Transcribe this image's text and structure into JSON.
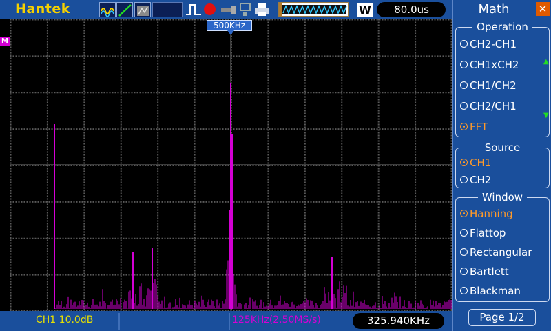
{
  "header": {
    "brand": "Hantek",
    "timebase": "80.0us",
    "trigger_mode_letter": "W"
  },
  "trigger_marker": {
    "label": "500KHz"
  },
  "channel_marker": {
    "label": "M"
  },
  "status": {
    "ch1_scale": "CH1 10.0dB",
    "sample_info": "125KHz(2.50MS/s)",
    "cursor_freq": "325.940KHz"
  },
  "menu": {
    "title": "Math",
    "operation": {
      "title": "Operation",
      "options": [
        "CH2-CH1",
        "CH1xCH2",
        "CH1/CH2",
        "CH2/CH1",
        "FFT"
      ],
      "selected": "FFT"
    },
    "source": {
      "title": "Source",
      "options": [
        "CH1",
        "CH2"
      ],
      "selected": "CH1"
    },
    "window": {
      "title": "Window",
      "options": [
        "Hanning",
        "Flattop",
        "Rectangular",
        "Bartlett",
        "Blackman"
      ],
      "selected": "Hanning"
    },
    "page": "Page 1/2"
  },
  "colors": {
    "background": "#000000",
    "panel": "#1a4f9c",
    "spectrum": "#d400d4",
    "highlight": "#ff9a2a",
    "brand": "#f4d000",
    "ch1": "#e8e000"
  },
  "icons": [
    "wave-icon",
    "slope-icon",
    "gray-icon",
    "pulse-icon",
    "record-icon",
    "usb-icon",
    "network-icon",
    "printer-icon",
    "close-icon"
  ]
}
